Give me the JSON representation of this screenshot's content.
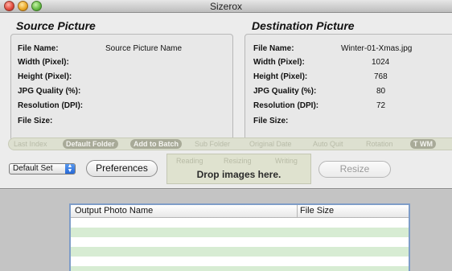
{
  "window": {
    "title": "Sizerox"
  },
  "source": {
    "title": "Source Picture",
    "labels": {
      "file_name": "File Name:",
      "width": "Width (Pixel):",
      "height": "Height (Pixel):",
      "jpg_quality": "JPG Quality (%):",
      "resolution": "Resolution (DPI):",
      "file_size": "File Size:"
    },
    "values": {
      "file_name": "Source Picture Name"
    }
  },
  "destination": {
    "title": "Destination Picture",
    "labels": {
      "file_name": "File Name:",
      "width": "Width (Pixel):",
      "height": "Height (Pixel):",
      "jpg_quality": "JPG Quality (%):",
      "resolution": "Resolution (DPI):",
      "file_size": "File Size:"
    },
    "values": {
      "file_name": "Winter-01-Xmas.jpg",
      "width": "1024",
      "height": "768",
      "jpg_quality": "80",
      "resolution": "72"
    }
  },
  "options_strip": {
    "last_index": "Last Index",
    "default_folder": "Default Folder",
    "add_to_batch": "Add to Batch",
    "sub_folder": "Sub Folder",
    "original_date": "Original Date",
    "auto_quit": "Auto Quit",
    "rotation": "Rotation",
    "t_wm": "T WM"
  },
  "controls": {
    "preset_select": "Default Set",
    "preferences_button": "Preferences",
    "resize_button": "Resize"
  },
  "dropzone": {
    "status_reading": "Reading",
    "status_resizing": "Resizing",
    "status_writing": "Writing",
    "text": "Drop images here."
  },
  "output_table": {
    "columns": [
      "Output Photo Name",
      "File Size"
    ]
  }
}
